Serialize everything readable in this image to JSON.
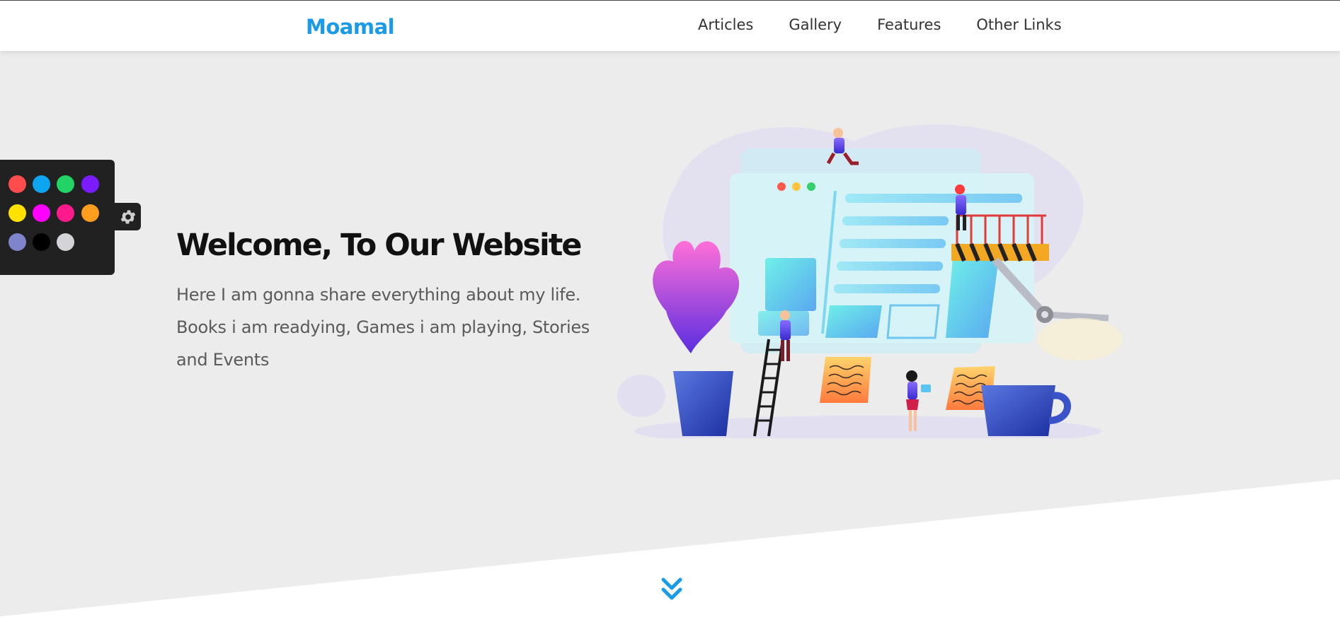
{
  "header": {
    "logo": "Moamal",
    "nav": [
      "Articles",
      "Gallery",
      "Features",
      "Other Links"
    ]
  },
  "hero": {
    "title": "Welcome, To Our Website",
    "text": "Here I am gonna share everything about my life. Books i am readying, Games i am playing, Stories and Events"
  },
  "color_switcher": {
    "colors": [
      "#ff4d4d",
      "#0ea5f0",
      "#22d465",
      "#7a1cff",
      "#ffe100",
      "#ff00ff",
      "#ff1a8c",
      "#ff9d1f",
      "#7f85cc",
      "#000000",
      "#d4d4d8"
    ],
    "icon": "gear-icon"
  },
  "scroll_down": {
    "icon": "double-chevron-down-icon"
  },
  "colors": {
    "accent": "#1a9bea",
    "landing_bg": "#ececec",
    "panel_bg": "#212121"
  }
}
